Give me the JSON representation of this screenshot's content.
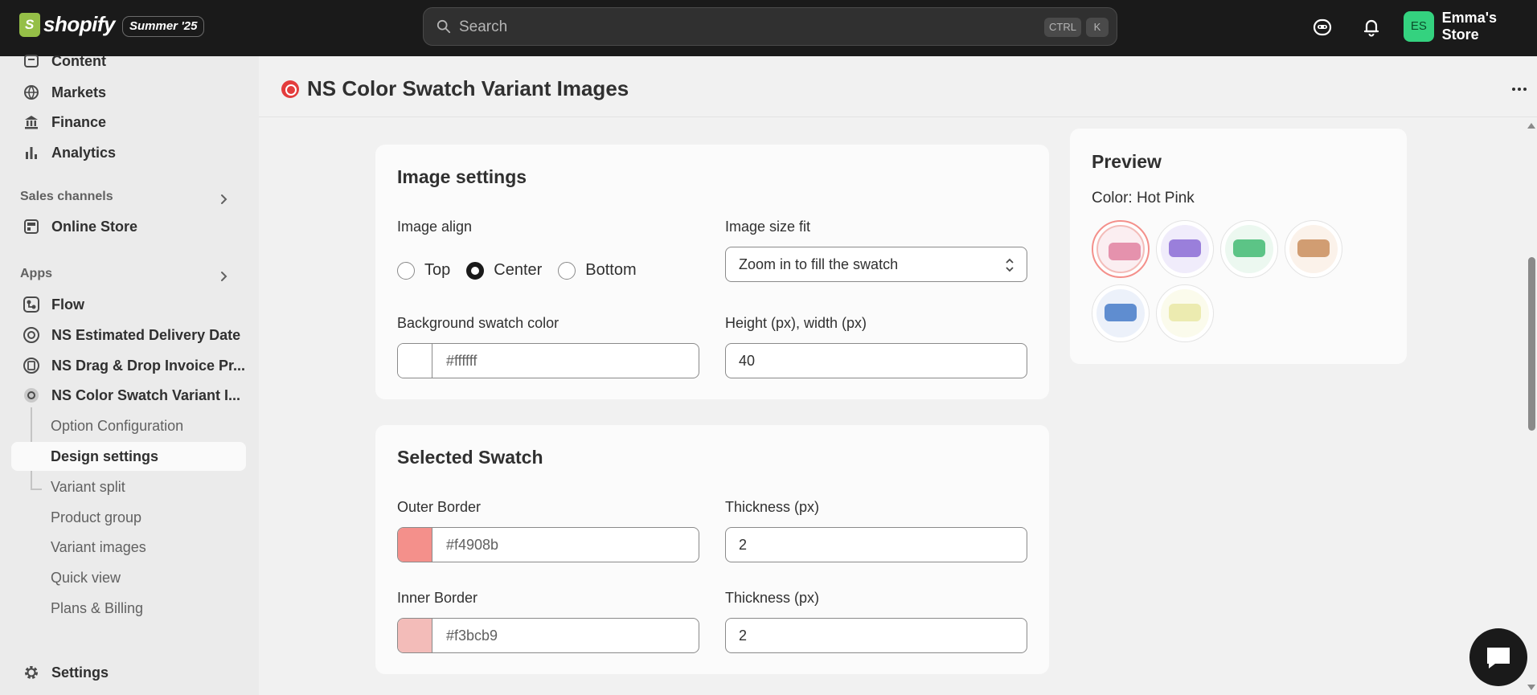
{
  "topbar": {
    "logo_text": "shopify",
    "badge": "Summer '25",
    "search_placeholder": "Search",
    "shortcut_ctrl": "CTRL",
    "shortcut_k": "K",
    "store_initials": "ES",
    "store_name": "Emma's Store"
  },
  "sidebar": {
    "items_top": [
      {
        "label": "Content",
        "icon": "content-icon"
      },
      {
        "label": "Markets",
        "icon": "globe-icon"
      },
      {
        "label": "Finance",
        "icon": "bank-icon"
      },
      {
        "label": "Analytics",
        "icon": "bar-chart-icon"
      }
    ],
    "sales_channels_title": "Sales channels",
    "online_store": "Online Store",
    "apps_title": "Apps",
    "apps": [
      {
        "label": "Flow"
      },
      {
        "label": "NS Estimated Delivery Date"
      },
      {
        "label": "NS Drag & Drop Invoice Pr..."
      },
      {
        "label": "NS Color Swatch Variant I..."
      }
    ],
    "sub_items": [
      {
        "label": "Option Configuration"
      },
      {
        "label": "Design settings"
      },
      {
        "label": "Variant split"
      },
      {
        "label": "Product group"
      },
      {
        "label": "Variant images"
      },
      {
        "label": "Quick view"
      },
      {
        "label": "Plans & Billing"
      }
    ],
    "settings": "Settings"
  },
  "page": {
    "title": "NS Color Swatch Variant Images"
  },
  "image_settings": {
    "title": "Image settings",
    "align_label": "Image align",
    "align_options": [
      "Top",
      "Center",
      "Bottom"
    ],
    "align_selected": "Center",
    "size_fit_label": "Image size fit",
    "size_fit_value": "Zoom in to fill the swatch",
    "bg_color_label": "Background swatch color",
    "bg_color_value": "#ffffff",
    "bg_color_hex": "#ffffff",
    "height_width_label": "Height (px), width (px)",
    "height_width_value": "40"
  },
  "selected_swatch": {
    "title": "Selected Swatch",
    "outer_border_label": "Outer Border",
    "outer_border_value": "#f4908b",
    "outer_thickness_label": "Thickness (px)",
    "outer_thickness_value": "2",
    "inner_border_label": "Inner Border",
    "inner_border_value": "#f3bcb9",
    "inner_thickness_label": "Thickness (px)",
    "inner_thickness_value": "2"
  },
  "preview": {
    "title": "Preview",
    "color_text": "Color: Hot Pink",
    "swatches": [
      {
        "name": "hot-pink",
        "bg": "#fbeef1",
        "pillow": "#e592ad",
        "selected": true
      },
      {
        "name": "purple",
        "bg": "#f0ecfb",
        "pillow": "#9a7fdb",
        "selected": false
      },
      {
        "name": "green",
        "bg": "#ecf8f0",
        "pillow": "#5cc486",
        "selected": false
      },
      {
        "name": "tan",
        "bg": "#fbf2ea",
        "pillow": "#d19d72",
        "selected": false
      },
      {
        "name": "blue",
        "bg": "#ecf1fa",
        "pillow": "#5f8dd0",
        "selected": false
      },
      {
        "name": "cream",
        "bg": "#fbfbec",
        "pillow": "#ecebb0",
        "selected": false
      }
    ]
  }
}
